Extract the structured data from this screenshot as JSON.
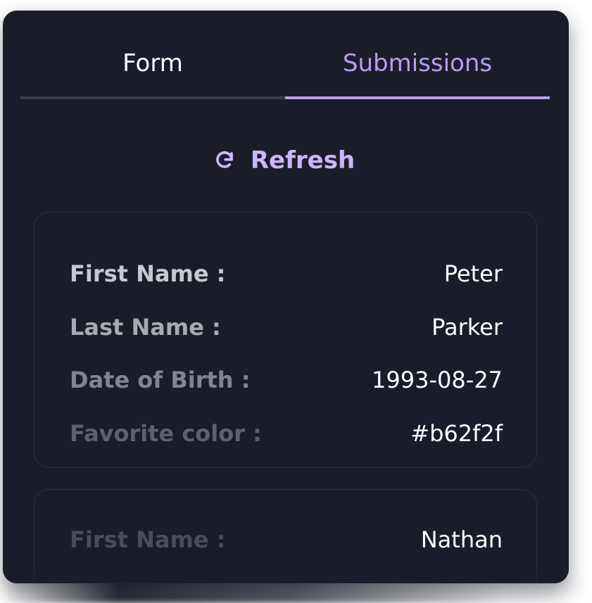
{
  "tabs": [
    {
      "label": "Form",
      "active": false
    },
    {
      "label": "Submissions",
      "active": true
    }
  ],
  "refresh": {
    "label": "Refresh",
    "icon": "refresh-icon"
  },
  "colors": {
    "panel_bg": "#1a1d29",
    "accent": "#b99cf0",
    "text": "#ffffff"
  },
  "submissions": [
    {
      "fields": [
        {
          "label": "First Name :",
          "value": "Peter"
        },
        {
          "label": "Last Name :",
          "value": "Parker"
        },
        {
          "label": "Date of Birth :",
          "value": "1993-08-27"
        },
        {
          "label": "Favorite color :",
          "value": "#b62f2f"
        }
      ]
    },
    {
      "fields": [
        {
          "label": "First Name :",
          "value": "Nathan"
        }
      ]
    }
  ]
}
